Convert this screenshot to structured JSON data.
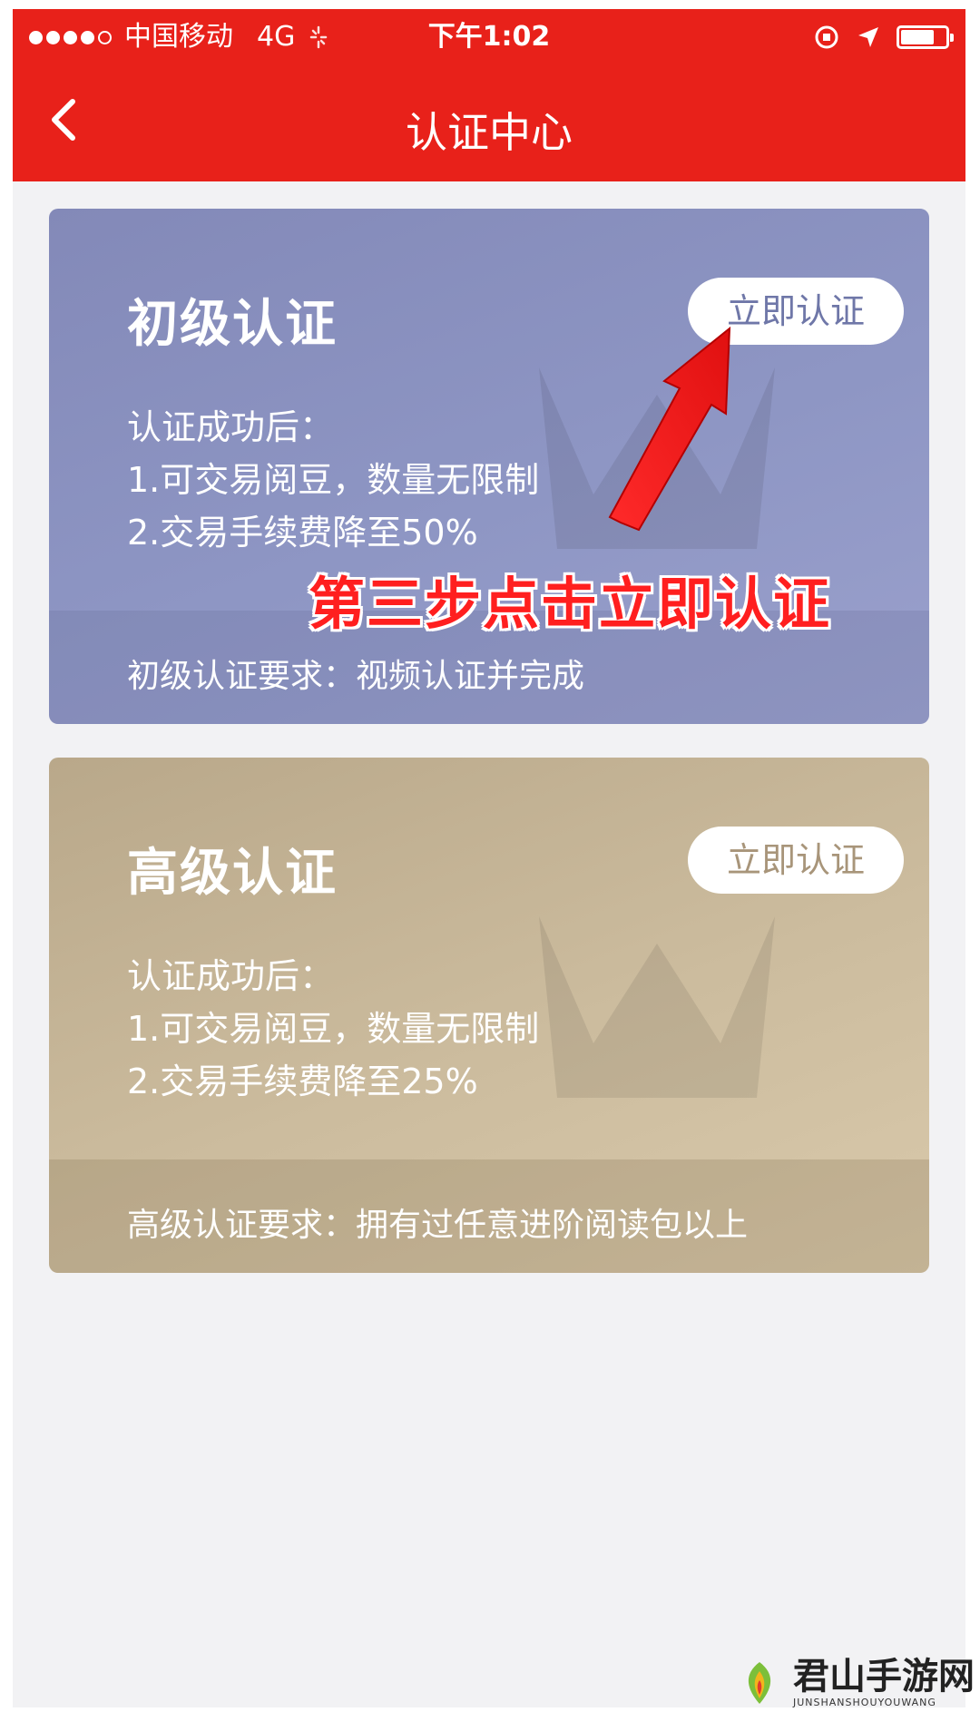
{
  "status_bar": {
    "carrier": "中国移动",
    "network": "4G",
    "time": "下午1:02",
    "signal_bars": 4,
    "battery_level": 0.7
  },
  "nav": {
    "title": "认证中心"
  },
  "cards": [
    {
      "title": "初级认证",
      "button": "立即认证",
      "benefits_heading": "认证成功后：",
      "benefit_1": "1.可交易阅豆，数量无限制",
      "benefit_2": "2.交易手续费降至50%",
      "requirement": "初级认证要求：视频认证并完成"
    },
    {
      "title": "高级认证",
      "button": "立即认证",
      "benefits_heading": "认证成功后：",
      "benefit_1": "1.可交易阅豆，数量无限制",
      "benefit_2": "2.交易手续费降至25%",
      "requirement": "高级认证要求：拥有过任意进阶阅读包以上"
    }
  ],
  "annotation": {
    "text": "第三步点击立即认证",
    "color": "#ff1f1f"
  },
  "watermark": {
    "name": "君山手游网",
    "sub": "JUNSHANSHOUYOUWANG"
  },
  "colors": {
    "header": "#e8211a",
    "basic_card": "#8e96c4",
    "advanced_card": "#ccbc9e"
  }
}
